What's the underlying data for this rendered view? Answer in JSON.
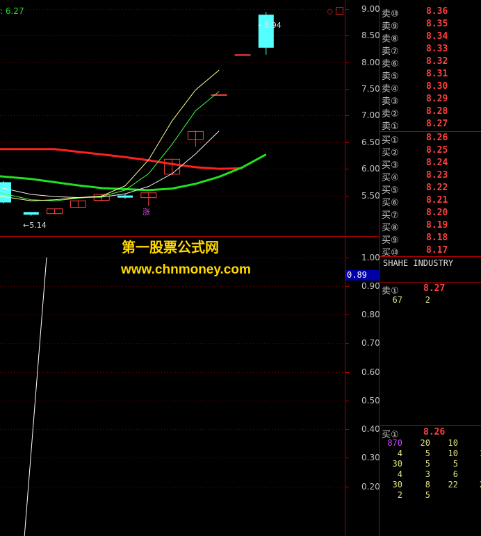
{
  "header": {
    "indicator_text": ": 6.27",
    "corner_icons": [
      "diamond-icon",
      "restore-icon"
    ]
  },
  "price_axis": {
    "labels": [
      "9.00",
      "8.50",
      "8.00",
      "7.50",
      "7.00",
      "6.50",
      "6.00",
      "5.50"
    ]
  },
  "price_annotations": {
    "high": "8.94",
    "low": "5.14",
    "tag": "涨"
  },
  "chart_data": [
    {
      "type": "candlestick",
      "ylim": [
        5.0,
        9.1
      ],
      "candles": [
        {
          "open": 5.75,
          "close": 5.37,
          "high": 5.77,
          "low": 5.35,
          "up": false
        },
        {
          "open": 5.14,
          "close": 5.19,
          "high": 5.19,
          "low": 5.12,
          "up": false
        },
        {
          "open": 5.16,
          "close": 5.25,
          "high": 5.25,
          "low": 5.16,
          "up": true
        },
        {
          "open": 5.28,
          "close": 5.4,
          "high": 5.41,
          "low": 5.26,
          "up": true
        },
        {
          "open": 5.41,
          "close": 5.52,
          "high": 5.53,
          "low": 5.39,
          "up": true
        },
        {
          "open": 5.5,
          "close": 5.46,
          "high": 5.53,
          "low": 5.44,
          "up": false
        },
        {
          "open": 5.46,
          "close": 5.55,
          "high": 5.56,
          "low": 5.3,
          "up": true
        },
        {
          "open": 5.9,
          "close": 6.18,
          "high": 6.19,
          "low": 5.88,
          "up": true
        },
        {
          "open": 6.55,
          "close": 6.7,
          "high": 6.72,
          "low": 6.41,
          "up": true
        },
        {
          "open": 7.39,
          "close": 7.39,
          "high": 7.39,
          "low": 7.39,
          "up": true
        },
        {
          "open": 8.14,
          "close": 8.14,
          "high": 8.14,
          "low": 8.14,
          "up": true
        },
        {
          "open": 8.27,
          "close": 8.89,
          "high": 8.94,
          "low": 8.14,
          "up": false
        }
      ],
      "ma_lines": [
        {
          "name": "",
          "color": "#ff2020",
          "values": [
            6.37,
            6.37,
            6.37,
            6.32,
            6.27,
            6.22,
            6.16,
            6.09,
            6.03,
            6.0,
            6.01
          ]
        },
        {
          "name": "",
          "color": "#20e020",
          "values": [
            5.86,
            5.81,
            5.75,
            5.69,
            5.64,
            5.62,
            5.6,
            5.63,
            5.72,
            5.85,
            6.03,
            6.27
          ]
        },
        {
          "name": "",
          "color": "#f0f0f0",
          "values": [
            5.65,
            5.52,
            5.48,
            5.46,
            5.47,
            5.53,
            5.67,
            5.91,
            6.28,
            6.71
          ]
        },
        {
          "name": "",
          "color": "#44ff44",
          "values": [
            5.55,
            5.42,
            5.4,
            5.45,
            5.48,
            5.6,
            5.91,
            6.46,
            7.09,
            7.45
          ]
        },
        {
          "name": "",
          "color": "#ffff99",
          "values": [
            5.49,
            5.4,
            5.42,
            5.46,
            5.49,
            5.68,
            6.17,
            6.9,
            7.48,
            7.85
          ]
        }
      ]
    },
    {
      "type": "line",
      "ylim": [
        0.0,
        1.05
      ],
      "axis_labels": [
        "1.00",
        "0.90",
        "0.80",
        "0.70",
        "0.60",
        "0.50",
        "0.40",
        "0.30",
        "0.20"
      ],
      "current_value": "0.89",
      "series": [
        {
          "name": "",
          "x": [
            0,
            1
          ],
          "y": [
            -0.04,
            1.0
          ]
        }
      ]
    }
  ],
  "watermark": {
    "title": "第一股票公式网",
    "url": "www.chnmoney.com"
  },
  "order_book": {
    "sell": [
      {
        "label": "卖⑩",
        "price": "8.36"
      },
      {
        "label": "卖⑨",
        "price": "8.35"
      },
      {
        "label": "卖⑧",
        "price": "8.34"
      },
      {
        "label": "卖⑦",
        "price": "8.33"
      },
      {
        "label": "卖⑥",
        "price": "8.32"
      },
      {
        "label": "卖⑤",
        "price": "8.31"
      },
      {
        "label": "卖④",
        "price": "8.30"
      },
      {
        "label": "卖③",
        "price": "8.29"
      },
      {
        "label": "卖②",
        "price": "8.28"
      },
      {
        "label": "卖①",
        "price": "8.27"
      }
    ],
    "buy": [
      {
        "label": "买①",
        "price": "8.26"
      },
      {
        "label": "买②",
        "price": "8.25"
      },
      {
        "label": "买③",
        "price": "8.24"
      },
      {
        "label": "买④",
        "price": "8.23"
      },
      {
        "label": "买⑤",
        "price": "8.22"
      },
      {
        "label": "买⑥",
        "price": "8.21"
      },
      {
        "label": "买⑦",
        "price": "8.20"
      },
      {
        "label": "买⑧",
        "price": "8.19"
      },
      {
        "label": "买⑨",
        "price": "8.18"
      },
      {
        "label": "买⑩",
        "price": "8.17"
      }
    ]
  },
  "detail": {
    "company": "SHAHE INDUSTRY",
    "sell1_label": "卖①",
    "sell1_price": "8.27",
    "sell1_queue": [
      "67",
      "2"
    ],
    "buy1_label": "买①",
    "buy1_price": "8.26",
    "buy1_queue": [
      [
        "870",
        "20",
        "10",
        ""
      ],
      [
        "4",
        "5",
        "10",
        "1"
      ],
      [
        "30",
        "5",
        "5",
        ""
      ],
      [
        "4",
        "3",
        "6",
        ""
      ],
      [
        "30",
        "8",
        "22",
        "2"
      ],
      [
        "2",
        "5",
        "",
        ""
      ]
    ]
  },
  "colors": {
    "up": "#ff4040",
    "down": "#54ffff",
    "axis": "#b00000",
    "grid": "#7a0000"
  }
}
